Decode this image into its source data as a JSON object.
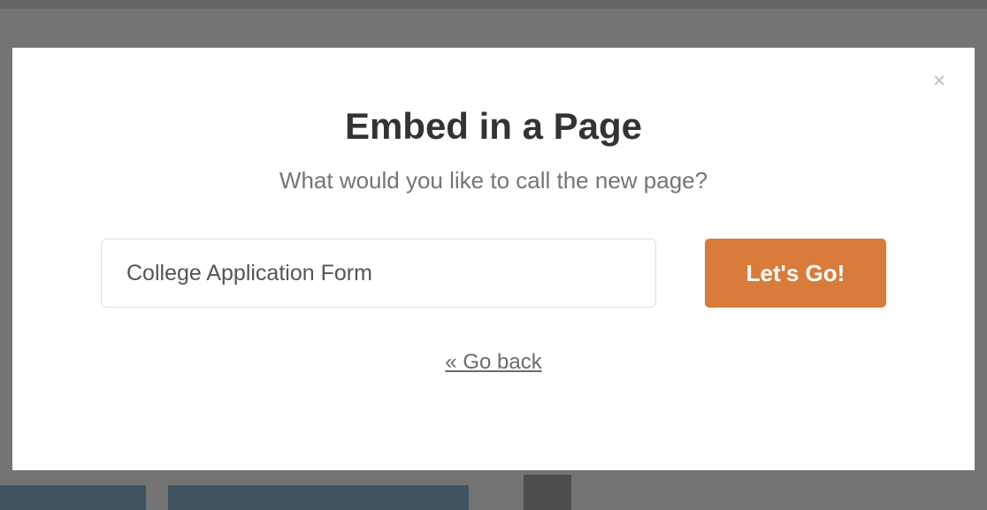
{
  "modal": {
    "title": "Embed in a Page",
    "subtitle": "What would you like to call the new page?",
    "input_value": "College Application Form",
    "go_button_label": "Let's Go!",
    "go_back_label": "« Go back",
    "close_icon_label": "×"
  },
  "colors": {
    "accent": "#d97b3b",
    "text_primary": "#333",
    "text_secondary": "#757575"
  }
}
